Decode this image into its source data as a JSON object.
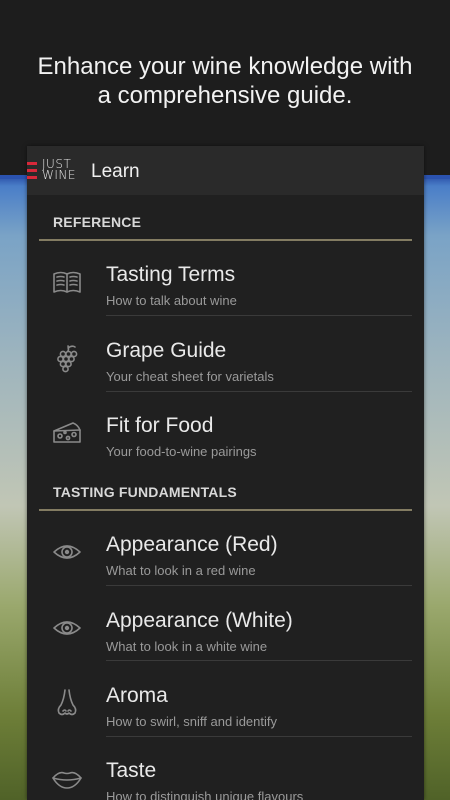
{
  "hero": {
    "tagline_line1": "Enhance your wine knowledge with",
    "tagline_line2": "a comprehensive guide."
  },
  "appbar": {
    "logo_line1": "JUST",
    "logo_line2": "WINE",
    "title": "Learn",
    "menu_icon": "menu-icon"
  },
  "colors": {
    "accent": "#d7283a",
    "section_rule": "#837c62",
    "panel": "#202020",
    "appbar": "#2a2a2a"
  },
  "sections": [
    {
      "header": "REFERENCE",
      "items": [
        {
          "title": "Tasting Terms",
          "subtitle": "How to talk about wine",
          "icon": "book-icon"
        },
        {
          "title": "Grape Guide",
          "subtitle": "Your cheat sheet for varietals",
          "icon": "grapes-icon"
        },
        {
          "title": "Fit for Food",
          "subtitle": "Your food-to-wine pairings",
          "icon": "cheese-icon"
        }
      ]
    },
    {
      "header": "TASTING FUNDAMENTALS",
      "items": [
        {
          "title": "Appearance (Red)",
          "subtitle": "What to look in a red wine",
          "icon": "eye-icon"
        },
        {
          "title": "Appearance (White)",
          "subtitle": "What to look in a white wine",
          "icon": "eye-icon"
        },
        {
          "title": "Aroma",
          "subtitle": "How to swirl, sniff and identify",
          "icon": "nose-icon"
        },
        {
          "title": "Taste",
          "subtitle": "How to distinguish unique flavours",
          "icon": "lips-icon"
        }
      ]
    }
  ]
}
